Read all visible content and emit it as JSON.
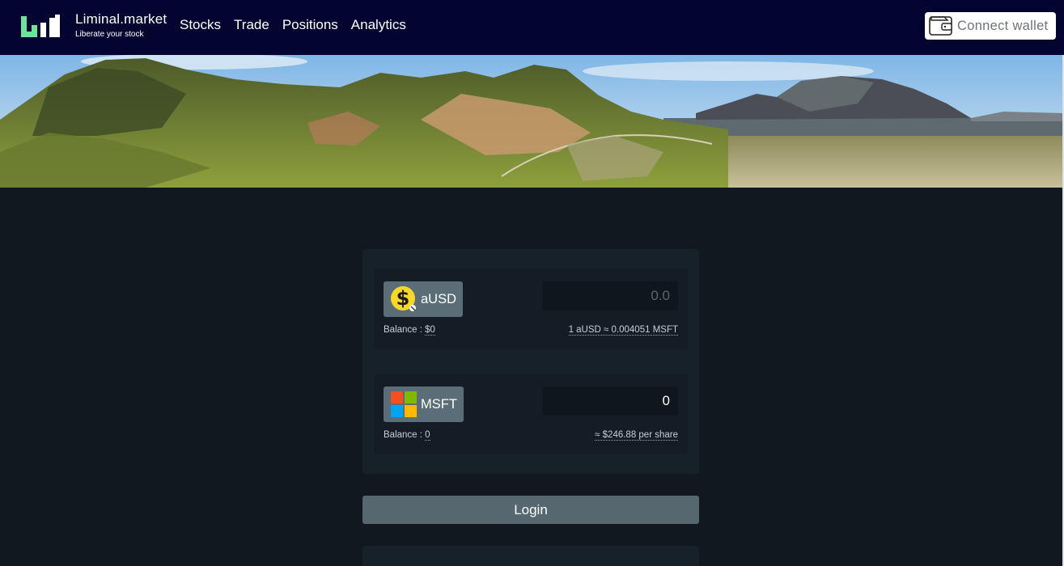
{
  "header": {
    "brand_name": "Liminal.market",
    "brand_tagline": "Liberate your stock",
    "nav": [
      {
        "label": "Stocks"
      },
      {
        "label": "Trade"
      },
      {
        "label": "Positions"
      },
      {
        "label": "Analytics"
      }
    ],
    "connect_wallet_label": "Connect wallet"
  },
  "swap": {
    "from": {
      "token": "aUSD",
      "icon": "dollar-coin-icon",
      "amount_placeholder": "0.0",
      "balance_label": "Balance : ",
      "balance_value": "$0",
      "rate": "1 aUSD ≈ 0.004051 MSFT"
    },
    "to": {
      "token": "MSFT",
      "icon": "microsoft-logo-icon",
      "amount": "0",
      "balance_label": "Balance : ",
      "balance_value": "0",
      "price": "≈ $246.88 per share"
    },
    "login_label": "Login"
  },
  "colors": {
    "header_bg": "#030530",
    "page_bg": "#111820",
    "card_bg": "#17212a",
    "button_bg": "#56676f",
    "logo_green": "#6fe39a"
  }
}
